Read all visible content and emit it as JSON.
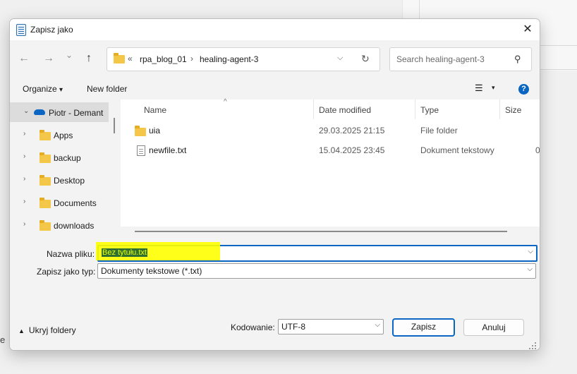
{
  "dialog": {
    "title": "Zapisz jako",
    "close": "✕"
  },
  "nav": {
    "back": "←",
    "forward": "→",
    "recent": "⌄",
    "up": "↑",
    "address": {
      "overflow": "«",
      "crumbs": [
        "rpa_blog_01",
        "healing-agent-3"
      ],
      "sep": "›",
      "dropdown": "⌵",
      "refresh": "↻"
    },
    "search_placeholder": "Search healing-agent-3"
  },
  "toolbar": {
    "organize": "Organize",
    "organize_arrow": "▾",
    "new_folder": "New folder",
    "view": "☰",
    "view_arrow": "▾",
    "help": "?"
  },
  "sidebar": {
    "items": [
      {
        "label": "Piotr - Demant",
        "chevron": "⌄",
        "selected": true,
        "icon": "cloud-icon"
      },
      {
        "label": "Apps",
        "chevron": "›",
        "icon": "folder-icon"
      },
      {
        "label": "backup",
        "chevron": "›",
        "icon": "folder-icon"
      },
      {
        "label": "Desktop",
        "chevron": "›",
        "icon": "folder-icon"
      },
      {
        "label": "Documents",
        "chevron": "›",
        "icon": "folder-icon"
      },
      {
        "label": "downloads",
        "chevron": "›",
        "icon": "folder-icon"
      }
    ]
  },
  "files": {
    "sort_arrow": "^",
    "columns": {
      "name": "Name",
      "date": "Date modified",
      "type": "Type",
      "size": "Size"
    },
    "rows": [
      {
        "name": "uia",
        "date": "29.03.2025 21:15",
        "type": "File folder",
        "size": "",
        "icon": "folder-icon"
      },
      {
        "name": "newfile.txt",
        "date": "15.04.2025 23:45",
        "type": "Dokument tekstowy",
        "size": "0",
        "icon": "text-file-icon"
      }
    ]
  },
  "form": {
    "filename_label": "Nazwa pliku:",
    "filename_value": "Bez tytułu.txt",
    "filetype_label": "Zapisz jako typ:",
    "filetype_value": "Dokumenty tekstowe (*.txt)",
    "dropdown_arrow": "⌵"
  },
  "footer": {
    "hide_folders": "Ukryj foldery",
    "hide_arrow": "▲",
    "encoding_label": "Kodowanie:",
    "encoding_value": "UTF-8",
    "save": "Zapisz",
    "cancel": "Anuluj"
  },
  "background": {
    "edge_char": "e"
  },
  "colors": {
    "accent": "#0a66c2",
    "highlight": "#ffff00",
    "selected_text_bg": "#2f6f31"
  }
}
